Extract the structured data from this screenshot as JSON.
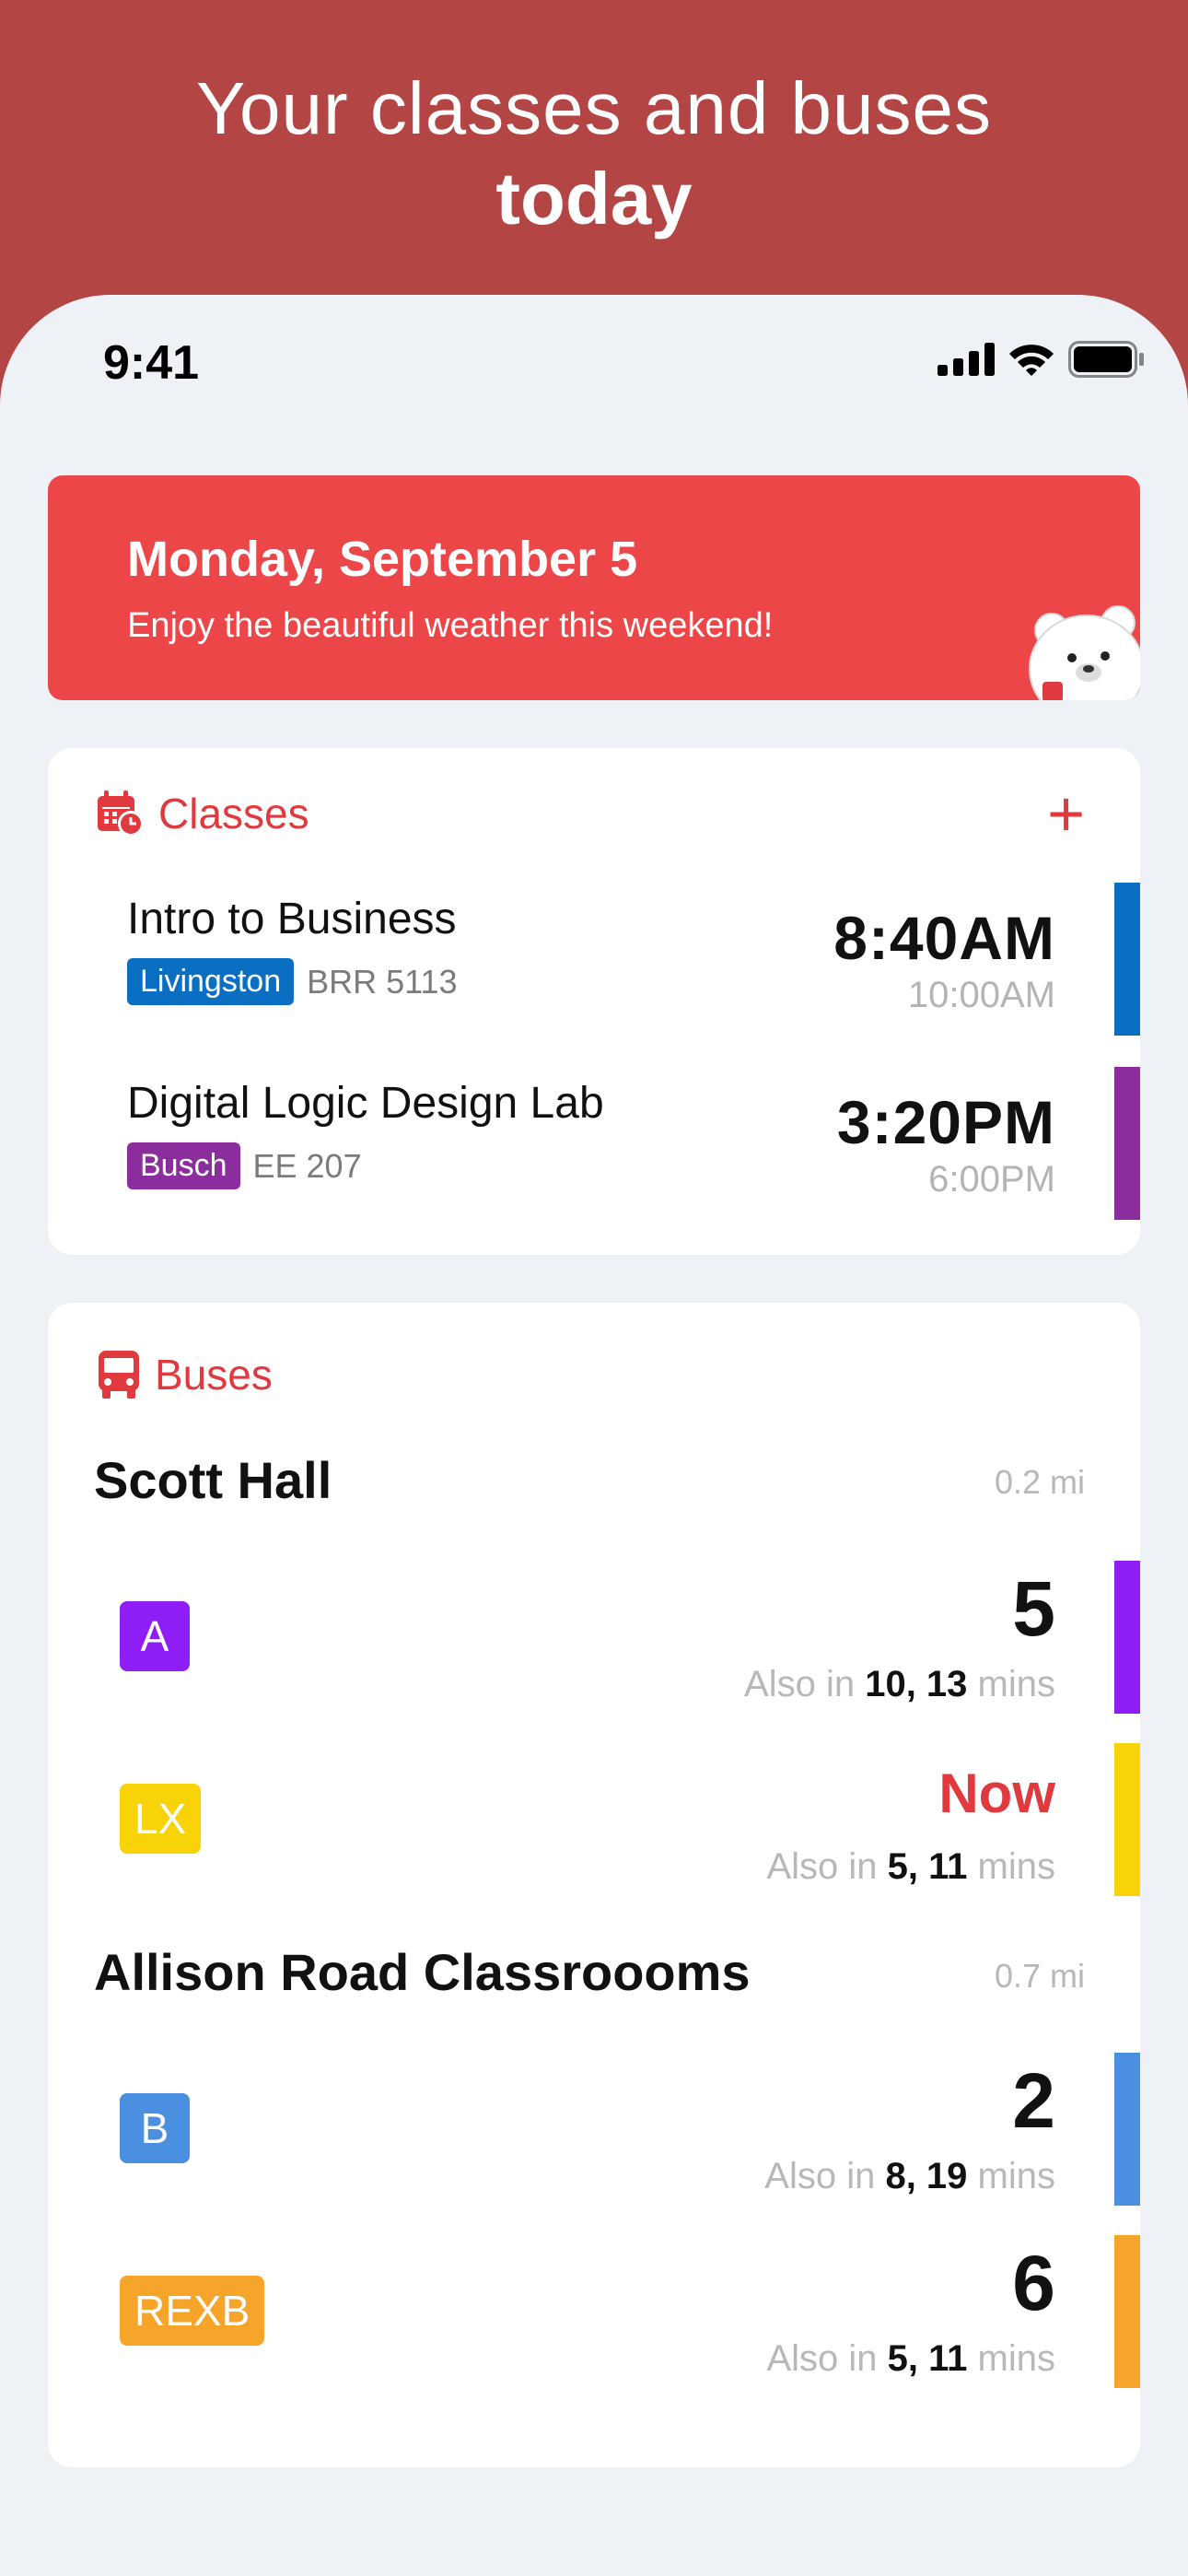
{
  "hero": {
    "line1": "Your classes and buses",
    "line2": "today"
  },
  "status_bar": {
    "time": "9:41"
  },
  "banner": {
    "date": "Monday, September 5",
    "message": "Enjoy the beautiful weather this weekend!",
    "mascot": "bear-mascot"
  },
  "classes": {
    "title": "Classes",
    "add_label": "+",
    "items": [
      {
        "name": "Intro to Business",
        "campus": "Livingston",
        "campus_color": "#0a6fc2",
        "room": "BRR 5113",
        "start": "8:40AM",
        "end": "10:00AM"
      },
      {
        "name": "Digital Logic Design Lab",
        "campus": "Busch",
        "campus_color": "#8b2d9c",
        "room": "EE 207",
        "start": "3:20PM",
        "end": "6:00PM"
      }
    ]
  },
  "buses": {
    "title": "Buses",
    "stops": [
      {
        "name": "Scott Hall",
        "distance": "0.2 mi",
        "routes": [
          {
            "route": "A",
            "color": "#8e1ef5",
            "eta": "5",
            "also_prefix": "Also in",
            "also_times": "10, 13",
            "also_suffix": "mins"
          },
          {
            "route": "LX",
            "color": "#f7d307",
            "eta": "Now",
            "also_prefix": "Also in",
            "also_times": "5, 11",
            "also_suffix": "mins"
          }
        ]
      },
      {
        "name": "Allison Road Classroooms",
        "distance": "0.7 mi",
        "routes": [
          {
            "route": "B",
            "color": "#4a8fe0",
            "eta": "2",
            "also_prefix": "Also in",
            "also_times": "8, 19",
            "also_suffix": "mins"
          },
          {
            "route": "REXB",
            "color": "#f6a52a",
            "eta": "6",
            "also_prefix": "Also in",
            "also_times": "5, 11",
            "also_suffix": "mins"
          }
        ]
      }
    ]
  }
}
